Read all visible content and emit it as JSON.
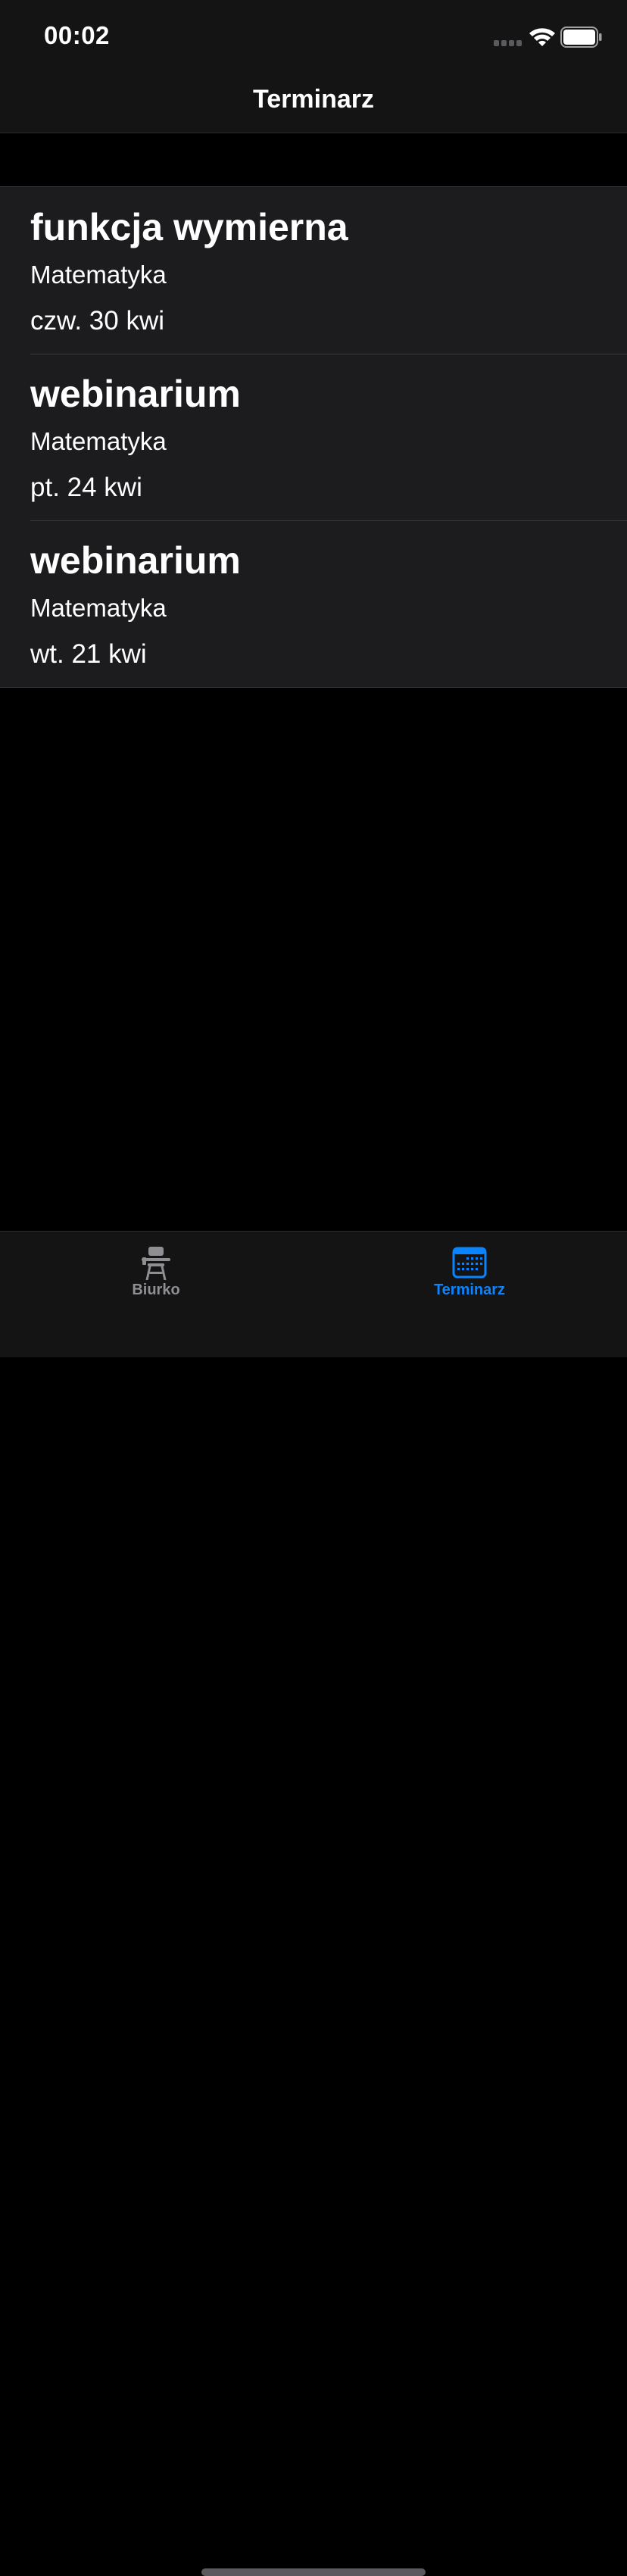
{
  "status_bar": {
    "time": "00:02"
  },
  "nav": {
    "title": "Terminarz"
  },
  "events": [
    {
      "title": "funkcja wymierna",
      "subject": "Matematyka",
      "date": "czw. 30 kwi"
    },
    {
      "title": "webinarium",
      "subject": "Matematyka",
      "date": "pt. 24 kwi"
    },
    {
      "title": "webinarium",
      "subject": "Matematyka",
      "date": "wt. 21 kwi"
    }
  ],
  "tabs": [
    {
      "label": "Biurko",
      "icon": "desk-icon",
      "selected": false
    },
    {
      "label": "Terminarz",
      "icon": "calendar-icon",
      "selected": true
    }
  ],
  "colors": {
    "accent": "#0a84ff",
    "inactive": "#8e8e93",
    "background": "#000000",
    "cell_background": "#1c1c1e"
  }
}
